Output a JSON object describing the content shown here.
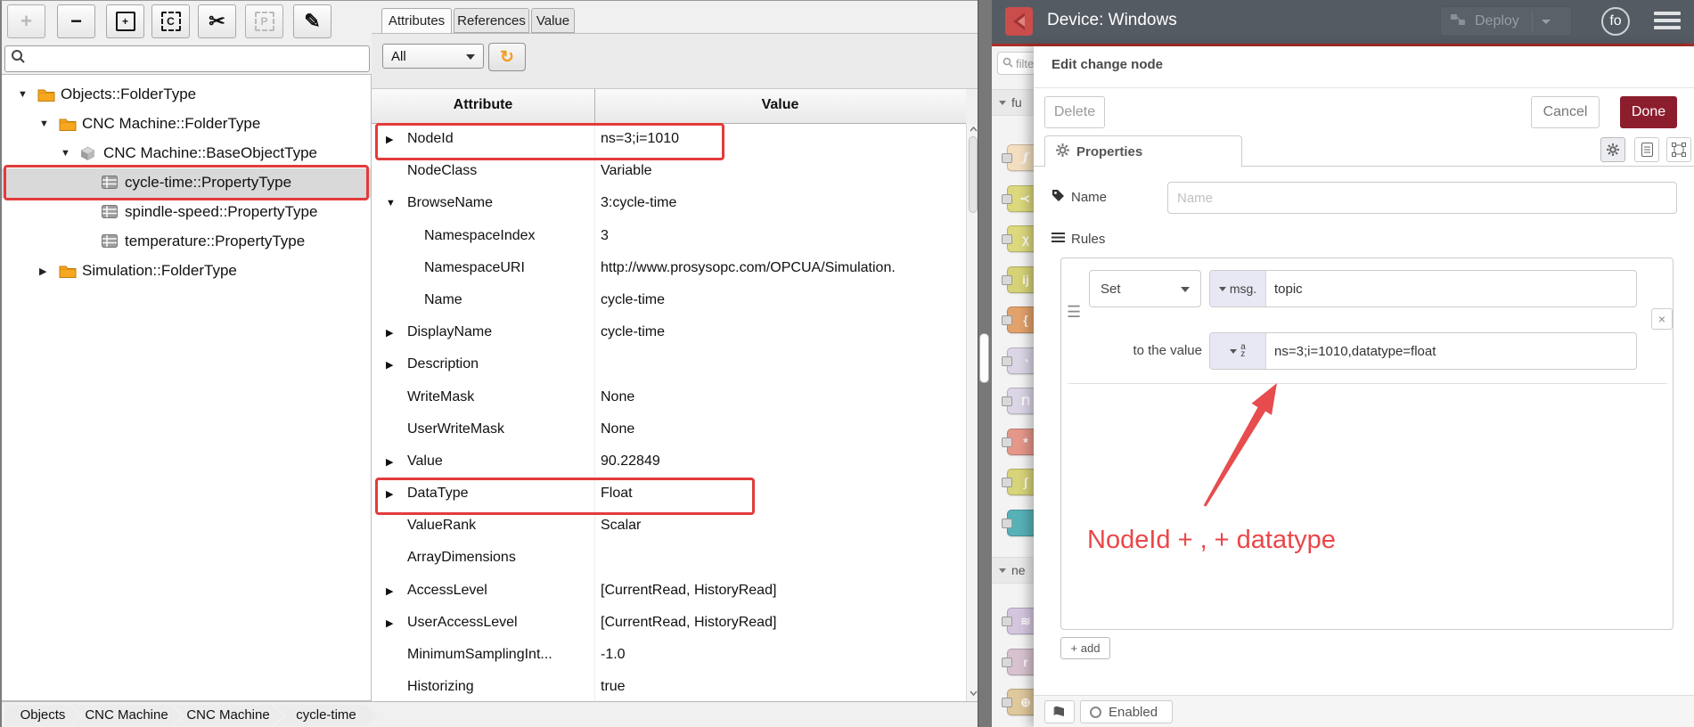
{
  "left_app": {
    "toolbar": {
      "buttons": [
        {
          "name": "add",
          "type": "glyph",
          "glyph": "+",
          "disabled": true
        },
        {
          "name": "remove",
          "type": "glyph",
          "glyph": "−",
          "disabled": false
        },
        {
          "name": "duplicate",
          "type": "box-solid",
          "glyph": "+",
          "disabled": false
        },
        {
          "name": "copy",
          "type": "box-dashed",
          "glyph": "C",
          "disabled": false
        },
        {
          "name": "cut",
          "type": "glyph",
          "glyph": "✂",
          "disabled": false
        },
        {
          "name": "paste",
          "type": "box-dashed",
          "glyph": "P",
          "disabled": true
        },
        {
          "name": "edit",
          "type": "glyph",
          "glyph": "✎",
          "disabled": false
        }
      ]
    },
    "search": {
      "value": "",
      "placeholder": ""
    },
    "tree": [
      {
        "label": "Objects::FolderType",
        "depth": 0,
        "expand": "open",
        "icon": "folder",
        "selected": false,
        "annotated": false
      },
      {
        "label": "CNC Machine::FolderType",
        "depth": 1,
        "expand": "open",
        "icon": "folder",
        "selected": false,
        "annotated": false
      },
      {
        "label": "CNC Machine::BaseObjectType",
        "depth": 2,
        "expand": "open",
        "icon": "cube",
        "selected": false,
        "annotated": false
      },
      {
        "label": "cycle-time::PropertyType",
        "depth": 3,
        "expand": "none",
        "icon": "property",
        "selected": true,
        "annotated": true
      },
      {
        "label": "spindle-speed::PropertyType",
        "depth": 3,
        "expand": "none",
        "icon": "property",
        "selected": false,
        "annotated": false
      },
      {
        "label": "temperature::PropertyType",
        "depth": 3,
        "expand": "none",
        "icon": "property",
        "selected": false,
        "annotated": false
      },
      {
        "label": "Simulation::FolderType",
        "depth": 1,
        "expand": "closed",
        "icon": "folder",
        "selected": false,
        "annotated": false
      }
    ],
    "tabs": {
      "items": [
        "Attributes",
        "References",
        "Value"
      ],
      "active": "Attributes"
    },
    "filter": {
      "value": "All"
    },
    "table": {
      "headers": [
        "Attribute",
        "Value"
      ],
      "rows": [
        {
          "attr": "NodeId",
          "value": "ns=3;i=1010",
          "expand": "closed",
          "indent": 0,
          "annotated": true
        },
        {
          "attr": "NodeClass",
          "value": "Variable",
          "expand": "none",
          "indent": 0,
          "annotated": false
        },
        {
          "attr": "BrowseName",
          "value": "3:cycle-time",
          "expand": "open",
          "indent": 0,
          "annotated": false
        },
        {
          "attr": "NamespaceIndex",
          "value": "3",
          "expand": "none",
          "indent": 1,
          "annotated": false
        },
        {
          "attr": "NamespaceURI",
          "value": "http://www.prosysopc.com/OPCUA/Simulation.",
          "expand": "none",
          "indent": 1,
          "annotated": false
        },
        {
          "attr": "Name",
          "value": "cycle-time",
          "expand": "none",
          "indent": 1,
          "annotated": false
        },
        {
          "attr": "DisplayName",
          "value": "cycle-time",
          "expand": "closed",
          "indent": 0,
          "annotated": false
        },
        {
          "attr": "Description",
          "value": "",
          "expand": "closed",
          "indent": 0,
          "annotated": false
        },
        {
          "attr": "WriteMask",
          "value": "None",
          "expand": "none",
          "indent": 0,
          "annotated": false
        },
        {
          "attr": "UserWriteMask",
          "value": "None",
          "expand": "none",
          "indent": 0,
          "annotated": false
        },
        {
          "attr": "Value",
          "value": "90.22849",
          "expand": "closed",
          "indent": 0,
          "annotated": false
        },
        {
          "attr": "DataType",
          "value": "Float",
          "expand": "closed",
          "indent": 0,
          "annotated": true
        },
        {
          "attr": "ValueRank",
          "value": "Scalar",
          "expand": "none",
          "indent": 0,
          "annotated": false
        },
        {
          "attr": "ArrayDimensions",
          "value": "",
          "expand": "none",
          "indent": 0,
          "annotated": false
        },
        {
          "attr": "AccessLevel",
          "value": "[CurrentRead, HistoryRead]",
          "expand": "closed",
          "indent": 0,
          "annotated": false
        },
        {
          "attr": "UserAccessLevel",
          "value": "[CurrentRead, HistoryRead]",
          "expand": "closed",
          "indent": 0,
          "annotated": false
        },
        {
          "attr": "MinimumSamplingInt...",
          "value": "-1.0",
          "expand": "none",
          "indent": 0,
          "annotated": false
        },
        {
          "attr": "Historizing",
          "value": "true",
          "expand": "none",
          "indent": 0,
          "annotated": false
        }
      ]
    },
    "breadcrumbs": [
      "Objects",
      "CNC Machine",
      "CNC Machine",
      "cycle-time"
    ]
  },
  "node_red": {
    "header": {
      "title": "Device: Windows",
      "deploy_label": "Deploy",
      "badge": "fo"
    },
    "palette": {
      "search_placeholder": "filte",
      "categories": [
        {
          "label": "fu",
          "nodes": [
            {
              "name": "function",
              "glyph": "ƒ",
              "color": "#f3dec0"
            },
            {
              "name": "switch",
              "glyph": "Y",
              "color": "#dcd87e"
            },
            {
              "name": "change",
              "glyph": "χ",
              "color": "#dcd87e"
            },
            {
              "name": "range",
              "glyph": "ij",
              "color": "#d6d278"
            },
            {
              "name": "template",
              "glyph": "{",
              "color": "#e2a26b"
            },
            {
              "name": "delay",
              "glyph": "◔",
              "color": "#dbd5e6"
            },
            {
              "name": "trigger",
              "glyph": "Π",
              "color": "#dbd5e6"
            },
            {
              "name": "exec",
              "glyph": "*",
              "color": "#e5978a"
            },
            {
              "name": "filter",
              "glyph": "∫",
              "color": "#d8d47b"
            },
            {
              "name": "link",
              "glyph": "",
              "color": "#57b2b8"
            }
          ]
        },
        {
          "label": "ne",
          "nodes": [
            {
              "name": "mqtt",
              "glyph": "≋",
              "color": "#d5c6e0"
            },
            {
              "name": "request",
              "glyph": "r",
              "color": "#d9c2cf"
            },
            {
              "name": "http",
              "glyph": "⊕",
              "color": "#dfc89c"
            }
          ]
        }
      ]
    },
    "tray": {
      "title": "Edit change node",
      "delete_label": "Delete",
      "cancel_label": "Cancel",
      "done_label": "Done",
      "tab_label": "Properties",
      "name_label": "Name",
      "name_placeholder": "Name",
      "rules_label": "Rules",
      "rule": {
        "action": "Set",
        "prefix": "msg.",
        "property": "topic",
        "to_label": "to the value",
        "type_a": "a",
        "type_z": "z",
        "value": "ns=3;i=1010,datatype=float",
        "remove_label": "×"
      },
      "add_label": "+ add",
      "enabled_label": "Enabled"
    },
    "annotation": {
      "text": "NodeId + , + datatype"
    }
  },
  "colors": {
    "annotation_red": "#e23b3b",
    "arrow_red": "#e74c4e",
    "done_bg": "#8c1d2c",
    "nr_header_bg": "#555b62",
    "folder_orange": "#f6a61f",
    "refresh_orange": "#f49b20",
    "selection_gray": "#d9d9d9"
  }
}
